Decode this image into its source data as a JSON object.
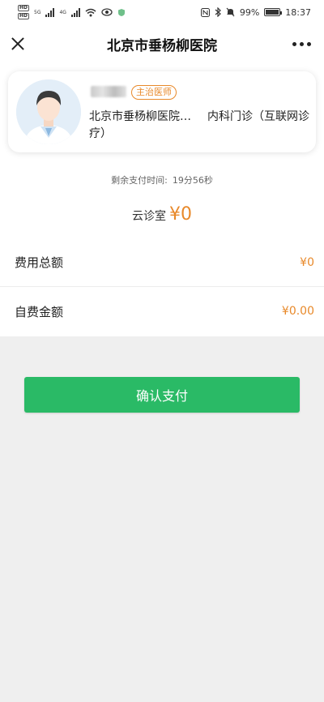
{
  "status_bar": {
    "left_badges": [
      "HD",
      "HD"
    ],
    "network": "5G",
    "network2": "4G",
    "battery": "99%",
    "time": "18:37"
  },
  "nav": {
    "title": "北京市垂杨柳医院",
    "close_icon": "close-icon",
    "more_icon": "more-icon"
  },
  "doctor": {
    "title_badge": "主治医师",
    "hospital": "北京市垂杨柳医院…",
    "department": "内科门诊（互联网诊疗）"
  },
  "payment": {
    "countdown_label": "剩余支付时间:",
    "countdown_value": "19分56秒",
    "service_label": "云诊室",
    "service_amount": "¥0"
  },
  "fees": [
    {
      "label": "费用总额",
      "value": "¥0"
    },
    {
      "label": "自费金额",
      "value": "¥0.00"
    }
  ],
  "actions": {
    "confirm_label": "确认支付"
  },
  "colors": {
    "accent_orange": "#e8892a",
    "primary_green": "#2aba66",
    "background": "#efefef"
  }
}
